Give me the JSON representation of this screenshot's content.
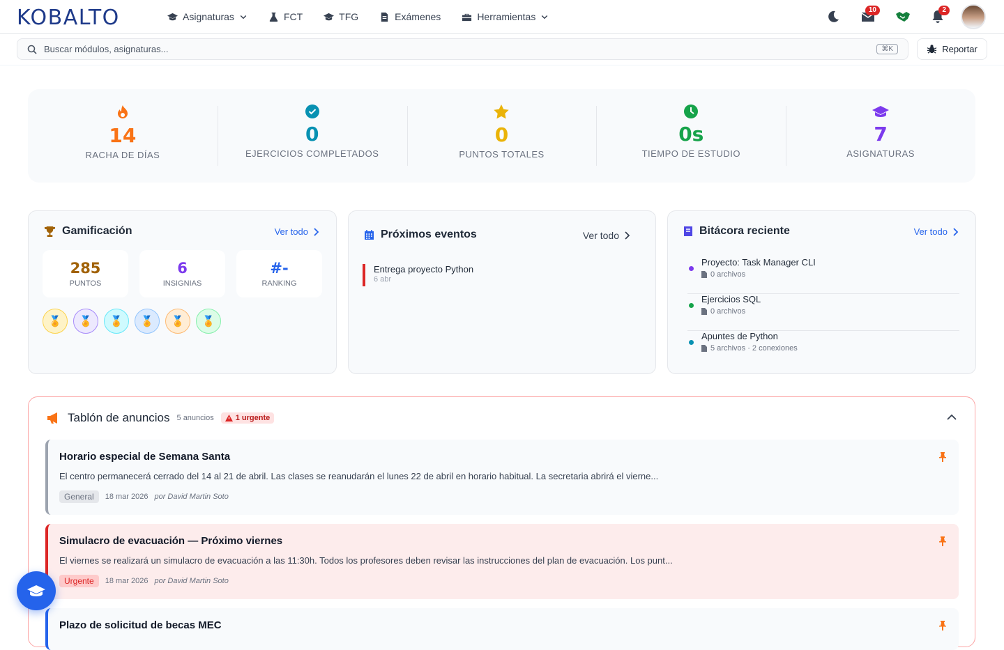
{
  "brand": {
    "logo": "KOBALTO"
  },
  "nav": {
    "items": [
      {
        "label": "Asignaturas",
        "icon": "graduation-cap-icon",
        "dropdown": true
      },
      {
        "label": "FCT",
        "icon": "flask-icon"
      },
      {
        "label": "TFG",
        "icon": "graduation-cap-icon"
      },
      {
        "label": "Exámenes",
        "icon": "document-icon"
      },
      {
        "label": "Herramientas",
        "icon": "toolbox-icon",
        "dropdown": true
      }
    ]
  },
  "topbar": {
    "messages_badge": "10",
    "notifications_badge": "2"
  },
  "search": {
    "placeholder": "Buscar módulos, asignaturas...",
    "shortcut": "⌘K"
  },
  "report": {
    "label": "Reportar"
  },
  "stats": [
    {
      "value": "14",
      "label": "RACHA DE DÍAS",
      "color": "#f97316",
      "icon": "fire-icon"
    },
    {
      "value": "0",
      "label": "EJERCICIOS COMPLETADOS",
      "color": "#0891b2",
      "icon": "check-circle-icon"
    },
    {
      "value": "0",
      "label": "PUNTOS TOTALES",
      "color": "#eab308",
      "icon": "star-icon"
    },
    {
      "value": "0s",
      "label": "TIEMPO DE ESTUDIO",
      "color": "#16a34a",
      "icon": "clock-icon"
    },
    {
      "value": "7",
      "label": "ASIGNATURAS",
      "color": "#7c3aed",
      "icon": "graduation-cap-icon"
    }
  ],
  "gamification": {
    "title": "Gamificación",
    "view_all": "Ver todo",
    "points": {
      "value": "285",
      "label": "PUNTOS"
    },
    "badges": {
      "value": "6",
      "label": "INSIGNIAS"
    },
    "ranking": {
      "value": "#-",
      "label": "RANKING"
    }
  },
  "events": {
    "title": "Próximos eventos",
    "view_all": "Ver todo",
    "items": [
      {
        "title": "Entrega proyecto Python",
        "date": "6 abr"
      }
    ]
  },
  "logbook": {
    "title": "Bitácora reciente",
    "view_all": "Ver todo",
    "items": [
      {
        "title": "Proyecto: Task Manager CLI",
        "meta": "0 archivos",
        "color": "#7c3aed"
      },
      {
        "title": "Ejercicios SQL",
        "meta": "0 archivos",
        "color": "#16a34a"
      },
      {
        "title": "Apuntes de Python",
        "meta": "5 archivos · 2 conexiones",
        "color": "#0891b2"
      }
    ]
  },
  "board": {
    "title": "Tablón de anuncios",
    "count": "5 anuncios",
    "urgent": "1 urgente",
    "items": [
      {
        "title": "Horario especial de Semana Santa",
        "body": "El centro permanecerá cerrado del 14 al 21 de abril. Las clases se reanudarán el lunes 22 de abril en horario habitual. La secretaria abrirá el vierne...",
        "tag": "General",
        "date": "18 mar 2026",
        "author": "por David Martin Soto"
      },
      {
        "title": "Simulacro de evacuación — Próximo viernes",
        "body": "El viernes se realizará un simulacro de evacuación a las 11:30h. Todos los profesores deben revisar las instrucciones del plan de evacuación. Los punt...",
        "tag": "Urgente",
        "date": "18 mar 2026",
        "author": "por David Martin Soto"
      },
      {
        "title": "Plazo de solicitud de becas MEC"
      }
    ]
  }
}
